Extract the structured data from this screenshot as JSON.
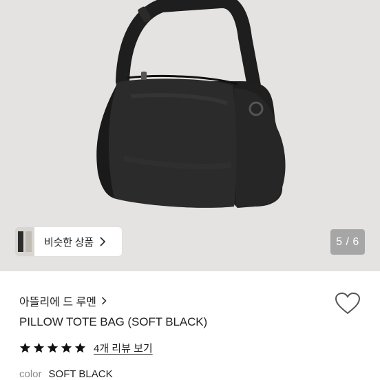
{
  "gallery": {
    "similar_button_label": "비슷한 상품",
    "counter": "5 / 6"
  },
  "product": {
    "brand": "아뜰리에 드 루멘",
    "title": "PILLOW TOTE BAG (SOFT BLACK)",
    "rating": 5,
    "reviews_link": "4개 리뷰 보기",
    "color_label": "color",
    "color_value": "SOFT BLACK"
  },
  "icons": {
    "heart": "heart-outline-icon",
    "chevron": "chevron-right-icon",
    "star": "star-filled-icon"
  },
  "colors": {
    "hero_background": "#e4e3e1",
    "counter_background": "#a6a6a6",
    "star": "#111111"
  }
}
